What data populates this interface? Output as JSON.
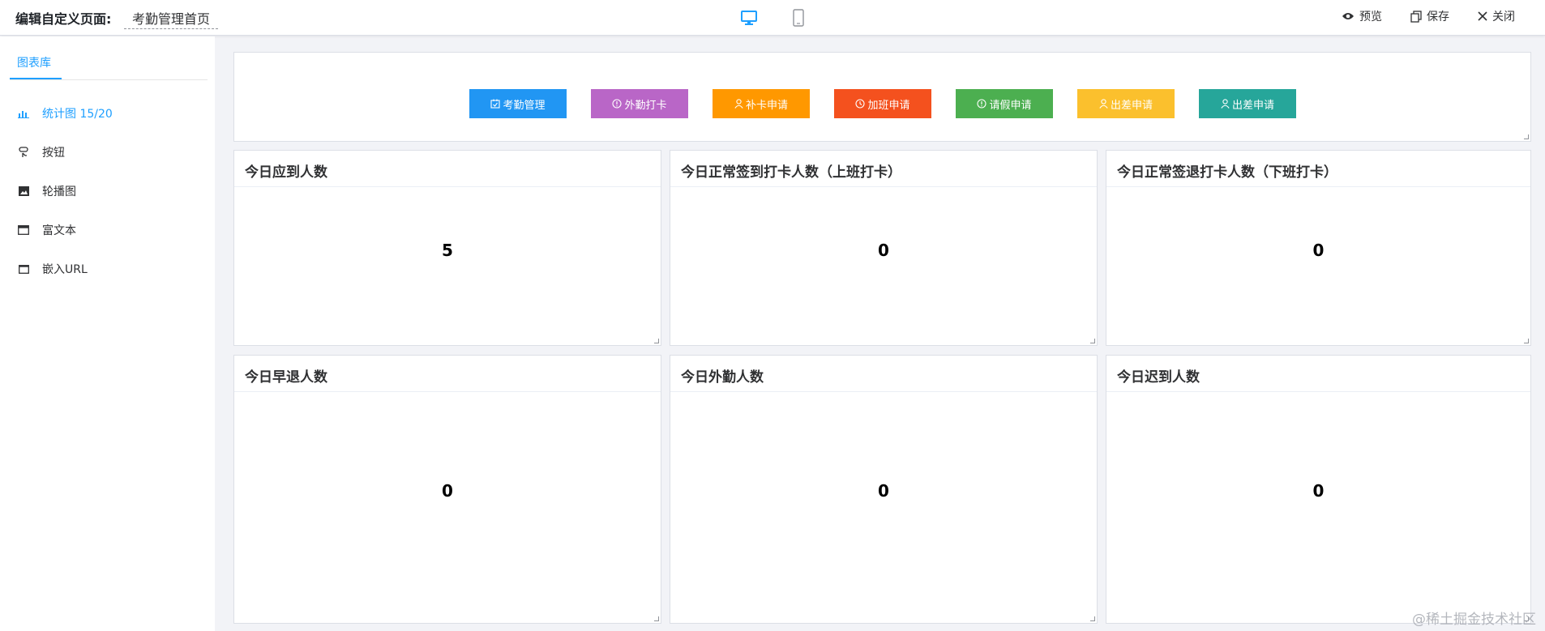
{
  "header": {
    "title": "编辑自定义页面:",
    "page_name": "考勤管理首页",
    "actions": {
      "preview": "预览",
      "save": "保存",
      "close": "关闭"
    },
    "devices": [
      "desktop-icon",
      "mobile-icon"
    ]
  },
  "sidebar": {
    "tab": "图表库",
    "items": [
      {
        "label": "统计图 15/20",
        "icon": "bar-chart-icon",
        "active": true
      },
      {
        "label": "按钮",
        "icon": "button-icon"
      },
      {
        "label": "轮播图",
        "icon": "image-icon"
      },
      {
        "label": "富文本",
        "icon": "rich-text-icon"
      },
      {
        "label": "嵌入URL",
        "icon": "embed-url-icon"
      }
    ]
  },
  "quick_buttons": [
    {
      "label": "考勤管理",
      "icon": "check-calendar-icon",
      "color": "#2196f3"
    },
    {
      "label": "外勤打卡",
      "icon": "info-circle-icon",
      "color": "#b966c7"
    },
    {
      "label": "补卡申请",
      "icon": "user-icon",
      "color": "#ff9800"
    },
    {
      "label": "加班申请",
      "icon": "clock-icon",
      "color": "#f4511e"
    },
    {
      "label": "请假申请",
      "icon": "info-circle-icon",
      "color": "#4caf50"
    },
    {
      "label": "出差申请",
      "icon": "user-icon",
      "color": "#fbc02d"
    },
    {
      "label": "出差申请",
      "icon": "user-icon",
      "color": "#26a69a"
    }
  ],
  "cards": [
    {
      "title": "今日应到人数",
      "value": "5"
    },
    {
      "title": "今日正常签到打卡人数（上班打卡）",
      "value": "0"
    },
    {
      "title": "今日正常签退打卡人数（下班打卡）",
      "value": "0"
    },
    {
      "title": "今日早退人数",
      "value": "0"
    },
    {
      "title": "今日外勤人数",
      "value": "0"
    },
    {
      "title": "今日迟到人数",
      "value": "0"
    }
  ],
  "watermark": "@稀土掘金技术社区"
}
